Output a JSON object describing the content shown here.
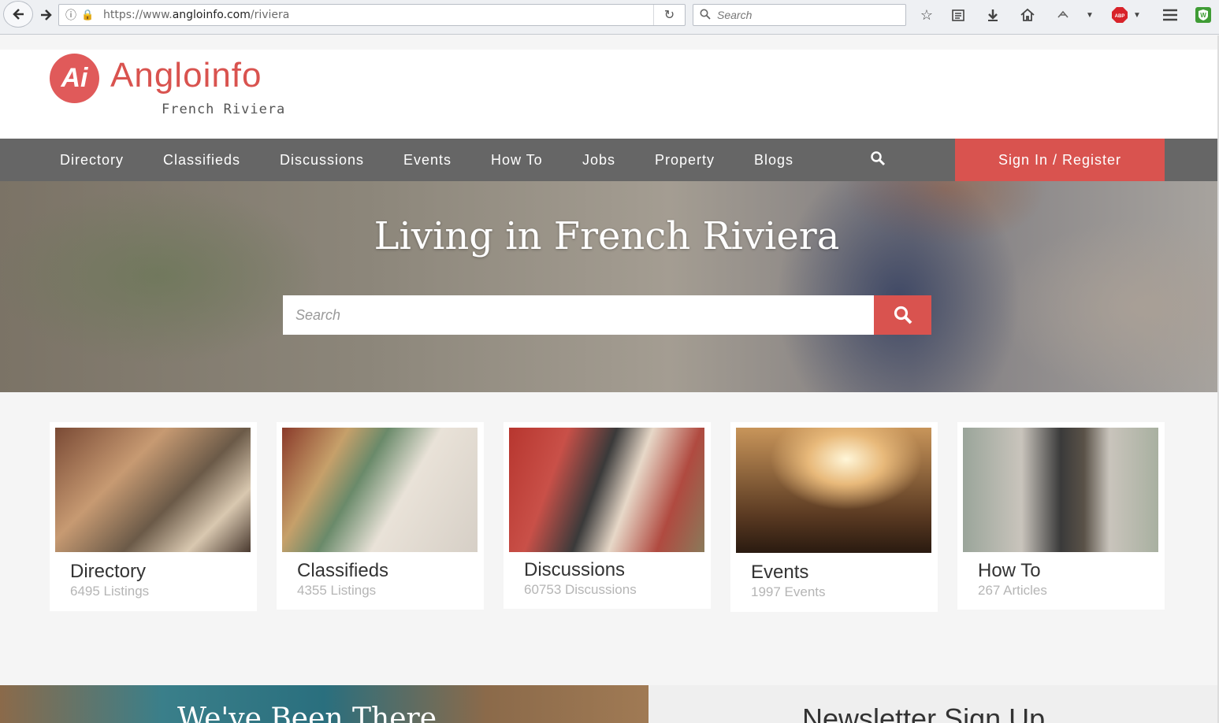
{
  "browser": {
    "url_prefix": "https://www.",
    "url_domain": "angloinfo.com",
    "url_path": "/riviera",
    "search_placeholder": "Search"
  },
  "site": {
    "logo_mark": "Ai",
    "logo_name_a": "Angl",
    "logo_name_b": "o",
    "logo_name_c": "info",
    "logo_region": "French Riviera"
  },
  "nav": {
    "items": [
      "Directory",
      "Classifieds",
      "Discussions",
      "Events",
      "How To",
      "Jobs",
      "Property",
      "Blogs"
    ],
    "signin_label": "Sign In / Register"
  },
  "hero": {
    "title": "Living in French Riviera",
    "search_placeholder": "Search"
  },
  "cards": [
    {
      "title": "Directory",
      "count": "6495 Listings"
    },
    {
      "title": "Classifieds",
      "count": "4355 Listings"
    },
    {
      "title": "Discussions",
      "count": "60753 Discussions"
    },
    {
      "title": "Events",
      "count": "1997 Events"
    },
    {
      "title": "How To",
      "count": "267 Articles"
    }
  ],
  "bottom": {
    "left_heading": "We've Been There",
    "right_heading": "Newsletter Sign Up"
  },
  "colors": {
    "accent": "#d9534f",
    "nav_bg": "#666666"
  }
}
